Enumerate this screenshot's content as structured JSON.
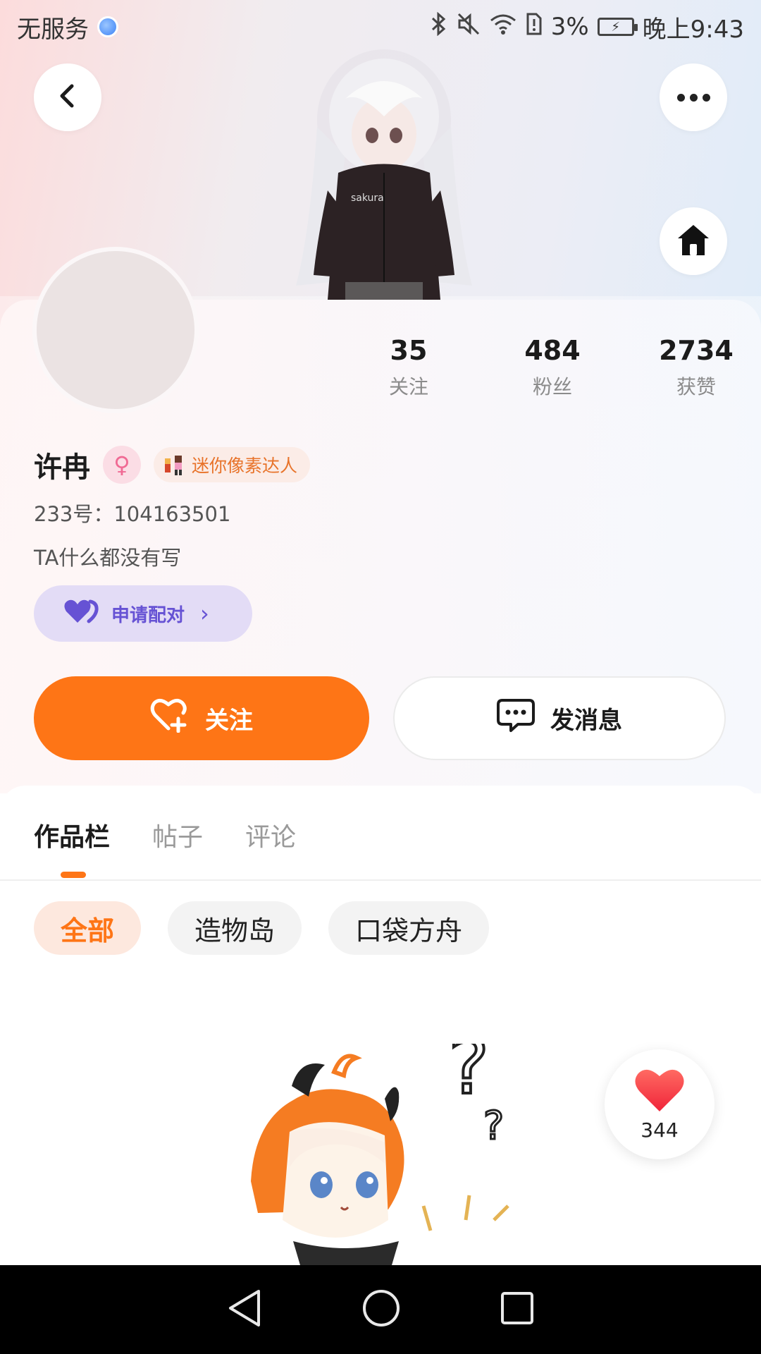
{
  "status_bar": {
    "carrier": "无服务",
    "battery_percent": "3%",
    "time": "晚上9:43",
    "icons": [
      "globe-icon",
      "bluetooth-icon",
      "mute-icon",
      "wifi-icon",
      "sim-alert-icon",
      "battery-charging-icon"
    ]
  },
  "header": {
    "back_icon": "back-arrow-icon",
    "more_icon": "more-dots-icon",
    "home_icon": "home-icon"
  },
  "profile": {
    "name": "许冉",
    "gender_icon": "female-icon",
    "badge_label": "迷你像素达人",
    "id_line": "233号：104163501",
    "bio": "TA什么都没有写",
    "pair_button_label": "申请配对"
  },
  "stats": [
    {
      "value": "35",
      "label": "关注"
    },
    {
      "value": "484",
      "label": "粉丝"
    },
    {
      "value": "2734",
      "label": "获赞"
    }
  ],
  "actions": {
    "follow_label": "关注",
    "message_label": "发消息"
  },
  "tabs": [
    {
      "label": "作品栏",
      "active": true
    },
    {
      "label": "帖子",
      "active": false
    },
    {
      "label": "评论",
      "active": false
    }
  ],
  "filters": [
    {
      "label": "全部",
      "active": true
    },
    {
      "label": "造物岛",
      "active": false
    },
    {
      "label": "口袋方舟",
      "active": false
    }
  ],
  "like_fab": {
    "count": "344"
  },
  "colors": {
    "accent": "#fe7516",
    "pair_purple": "#6652d4",
    "pair_bg": "#e3dcf6",
    "gender_pink": "#f06a94"
  }
}
